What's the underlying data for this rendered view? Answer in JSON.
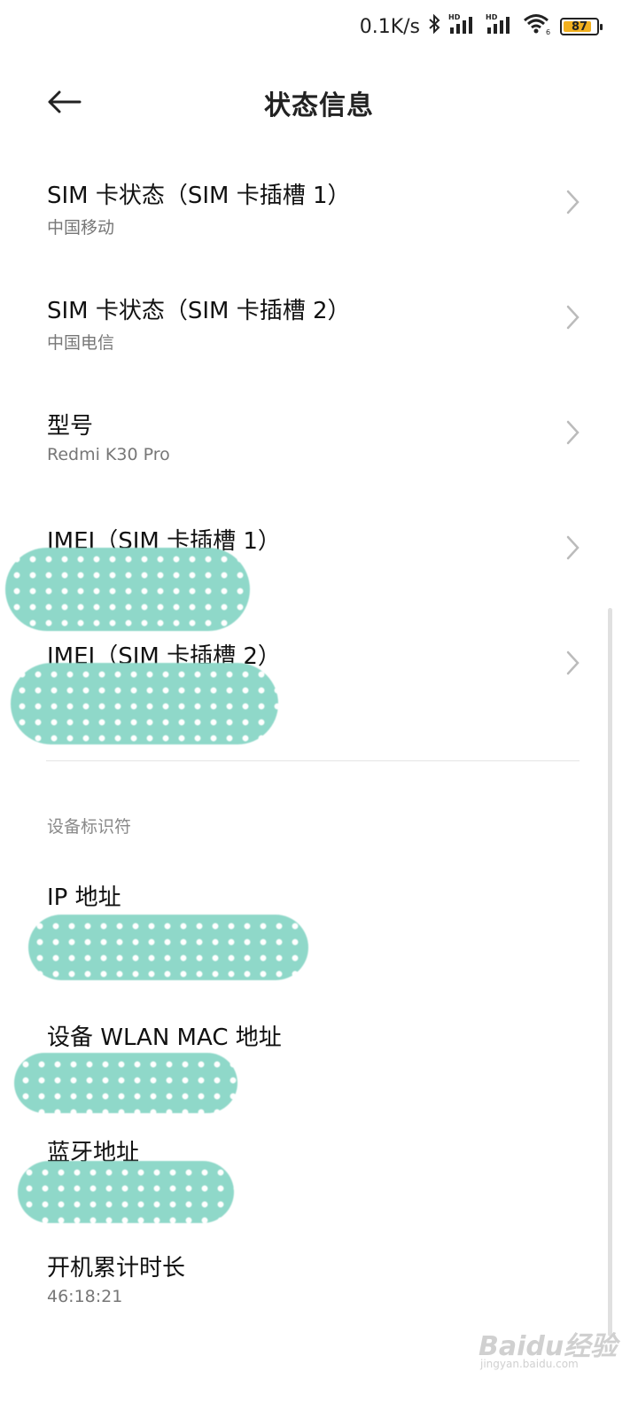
{
  "status_bar": {
    "network_speed": "0.1K/s",
    "sim1_tag": "HD",
    "sim2_tag": "HD",
    "wifi_tag": "6",
    "battery_level": "87",
    "battery_fraction": 0.87,
    "battery_color": "#f2b01e",
    "icons": [
      "bluetooth-icon",
      "signal-sim1-icon",
      "signal-sim2-icon",
      "wifi-icon",
      "battery-icon"
    ]
  },
  "header": {
    "title": "状态信息",
    "back_icon": "arrow-left-icon"
  },
  "items": [
    {
      "title": "SIM 卡状态（SIM 卡插槽 1）",
      "subtitle": "中国移动"
    },
    {
      "title": "SIM 卡状态（SIM 卡插槽 2）",
      "subtitle": "中国电信"
    },
    {
      "title": "型号",
      "subtitle": "Redmi K30 Pro"
    },
    {
      "title": "IMEI（SIM 卡插槽 1）",
      "subtitle": ""
    },
    {
      "title": "IMEI（SIM 卡插槽 2）",
      "subtitle": ""
    }
  ],
  "section_device_ids": {
    "label": "设备标识符",
    "items": [
      {
        "title": "IP 地址",
        "subtitle": ""
      },
      {
        "title": "设备 WLAN MAC 地址",
        "subtitle": ""
      },
      {
        "title": "蓝牙地址",
        "subtitle": ""
      },
      {
        "title": "开机累计时长",
        "subtitle": "46:18:21"
      }
    ]
  },
  "watermark": {
    "main": "Baidu经验",
    "sub": "jingyan.baidu.com"
  },
  "colors": {
    "mask": "#8fd8c9",
    "chevron": "#bbbbbb"
  }
}
